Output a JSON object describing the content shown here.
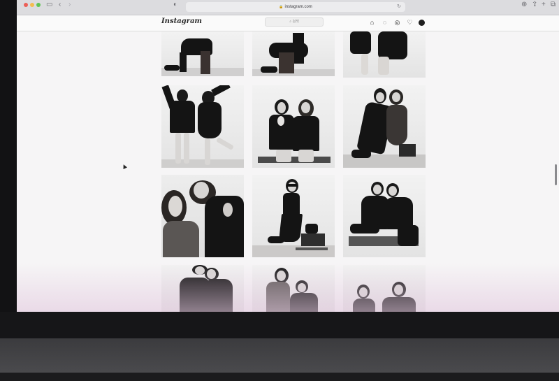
{
  "browser": {
    "url": "instagram.com",
    "lock_icon": "lock-icon"
  },
  "instagram": {
    "logo_text": "Instagram",
    "search_placeholder": "검색",
    "nav_icons": [
      "home-icon",
      "messenger-icon",
      "explore-icon",
      "heart-icon",
      "profile-avatar"
    ]
  },
  "feed": {
    "rows": 4,
    "columns": 3,
    "photos": [
      {
        "row": 1,
        "col": 1,
        "subject": "seated-person-on-stool"
      },
      {
        "row": 1,
        "col": 2,
        "subject": "seated-person-on-stool"
      },
      {
        "row": 1,
        "col": 3,
        "subject": "two-people-posing"
      },
      {
        "row": 2,
        "col": 1,
        "subject": "two-people-dancing"
      },
      {
        "row": 2,
        "col": 2,
        "subject": "two-people-seated-on-bench"
      },
      {
        "row": 2,
        "col": 3,
        "subject": "two-people-with-sunglasses"
      },
      {
        "row": 3,
        "col": 1,
        "subject": "two-people-close-up"
      },
      {
        "row": 3,
        "col": 2,
        "subject": "person-with-sunglasses-standing"
      },
      {
        "row": 3,
        "col": 3,
        "subject": "two-people-seated-on-bench"
      },
      {
        "row": 4,
        "col": 1,
        "subject": "two-people-portrait"
      },
      {
        "row": 4,
        "col": 2,
        "subject": "two-people-portrait"
      },
      {
        "row": 4,
        "col": 3,
        "subject": "two-people-portrait"
      }
    ]
  },
  "colors": {
    "page_bg": "#f6f5f6",
    "traffic_red": "#ec5f57",
    "traffic_yellow": "#f4bd4f",
    "traffic_green": "#5fc454"
  }
}
